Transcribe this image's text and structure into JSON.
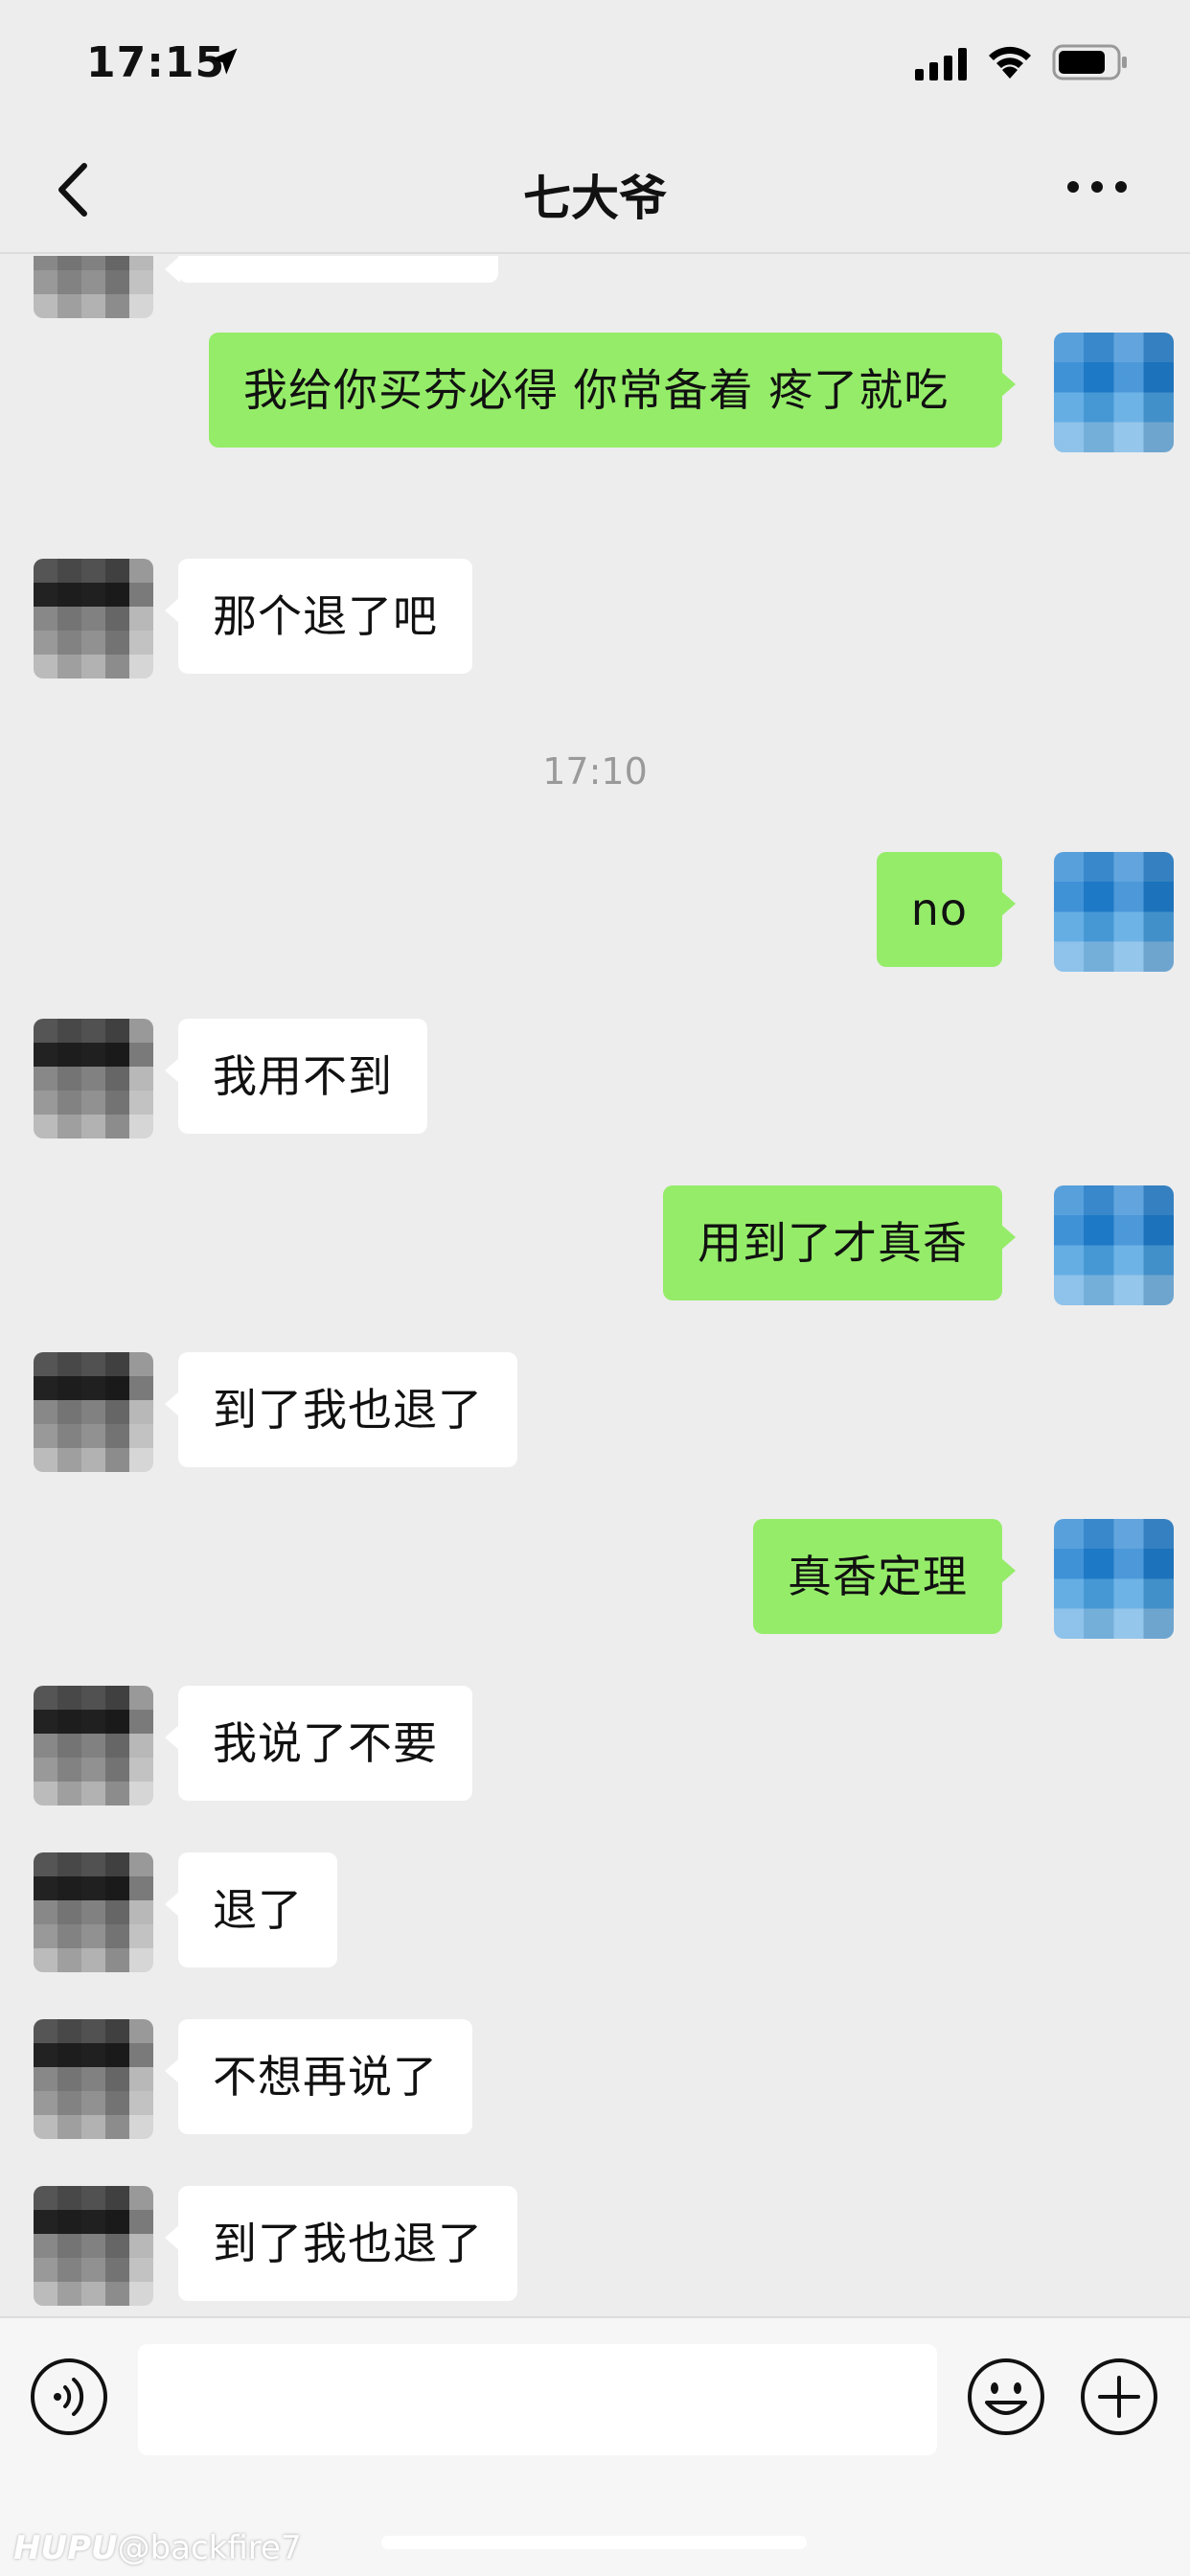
{
  "status_bar": {
    "time": "17:15"
  },
  "nav": {
    "title": "七大爷"
  },
  "messages": [
    {
      "side": "right",
      "text": "我给你买芬必得 你常备着 疼了就吃"
    },
    {
      "side": "left",
      "text": "那个退了吧"
    },
    {
      "time_divider": "17:10"
    },
    {
      "side": "right",
      "text": "no"
    },
    {
      "side": "left",
      "text": "我用不到"
    },
    {
      "side": "right",
      "text": "用到了才真香"
    },
    {
      "side": "left",
      "text": "到了我也退了"
    },
    {
      "side": "right",
      "text": "真香定理"
    },
    {
      "side": "left",
      "text": "我说了不要"
    },
    {
      "side": "left",
      "text": "退了"
    },
    {
      "side": "left",
      "text": "不想再说了"
    },
    {
      "side": "left",
      "text": "到了我也退了"
    }
  ],
  "input": {
    "placeholder": ""
  },
  "watermark": {
    "brand": "HUPU",
    "handle": "@backfire7"
  },
  "colors": {
    "background": "#ededed",
    "outgoing_bubble": "#95ec69",
    "incoming_bubble": "#ffffff"
  },
  "icons": [
    "location-arrow-icon",
    "signal-icon",
    "wifi-icon",
    "battery-icon",
    "back-chevron-icon",
    "more-dots-icon",
    "voice-icon",
    "emoji-icon",
    "plus-icon"
  ]
}
